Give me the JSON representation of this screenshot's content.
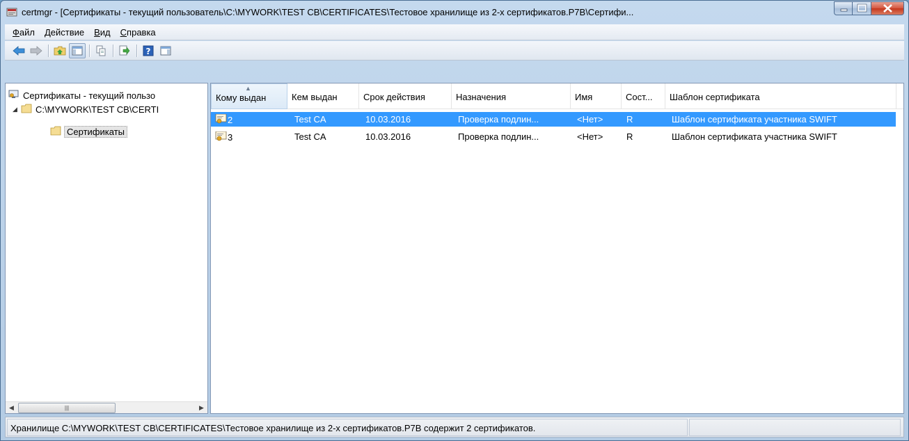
{
  "window": {
    "title": "certmgr - [Сертификаты - текущий пользователь\\C:\\MYWORK\\TEST CB\\CERTIFICATES\\Тестовое хранилище из 2-х сертификатов.P7B\\Сертифи..."
  },
  "menu": [
    {
      "label": "Файл"
    },
    {
      "label": "Действие"
    },
    {
      "label": "Вид"
    },
    {
      "label": "Справка"
    }
  ],
  "toolbar": {
    "icons": [
      "back-arrow-icon",
      "forward-arrow-icon",
      "up-folder-icon",
      "show-hide-tree-icon",
      "copy-icon",
      "export-icon",
      "help-icon",
      "action-pane-icon"
    ]
  },
  "tree": {
    "root": "Сертификаты - текущий пользо",
    "store": "C:\\MYWORK\\TEST CB\\CERTI",
    "folder": "Сертификаты"
  },
  "list": {
    "columns": [
      "Кому выдан",
      "Кем выдан",
      "Срок действия",
      "Назначения",
      "Имя",
      "Сост...",
      "Шаблон сертификата"
    ],
    "rows": [
      {
        "issued_to": "2",
        "issued_by": "Test CA",
        "expires": "10.03.2016",
        "purposes": "Проверка подлин...",
        "name": "<Нет>",
        "status": "R",
        "template": "Шаблон сертификата участника SWIFT",
        "selected": true
      },
      {
        "issued_to": "3",
        "issued_by": "Test CA",
        "expires": "10.03.2016",
        "purposes": "Проверка подлин...",
        "name": "<Нет>",
        "status": "R",
        "template": "Шаблон сертификата участника SWIFT",
        "selected": false
      }
    ]
  },
  "status": {
    "text": "Хранилище C:\\MYWORK\\TEST CB\\CERTIFICATES\\Тестовое хранилище из 2-х сертификатов.P7B содержит 2 сертификатов."
  },
  "colors": {
    "selection": "#3399ff",
    "window_frame": "#b9d1ea"
  }
}
